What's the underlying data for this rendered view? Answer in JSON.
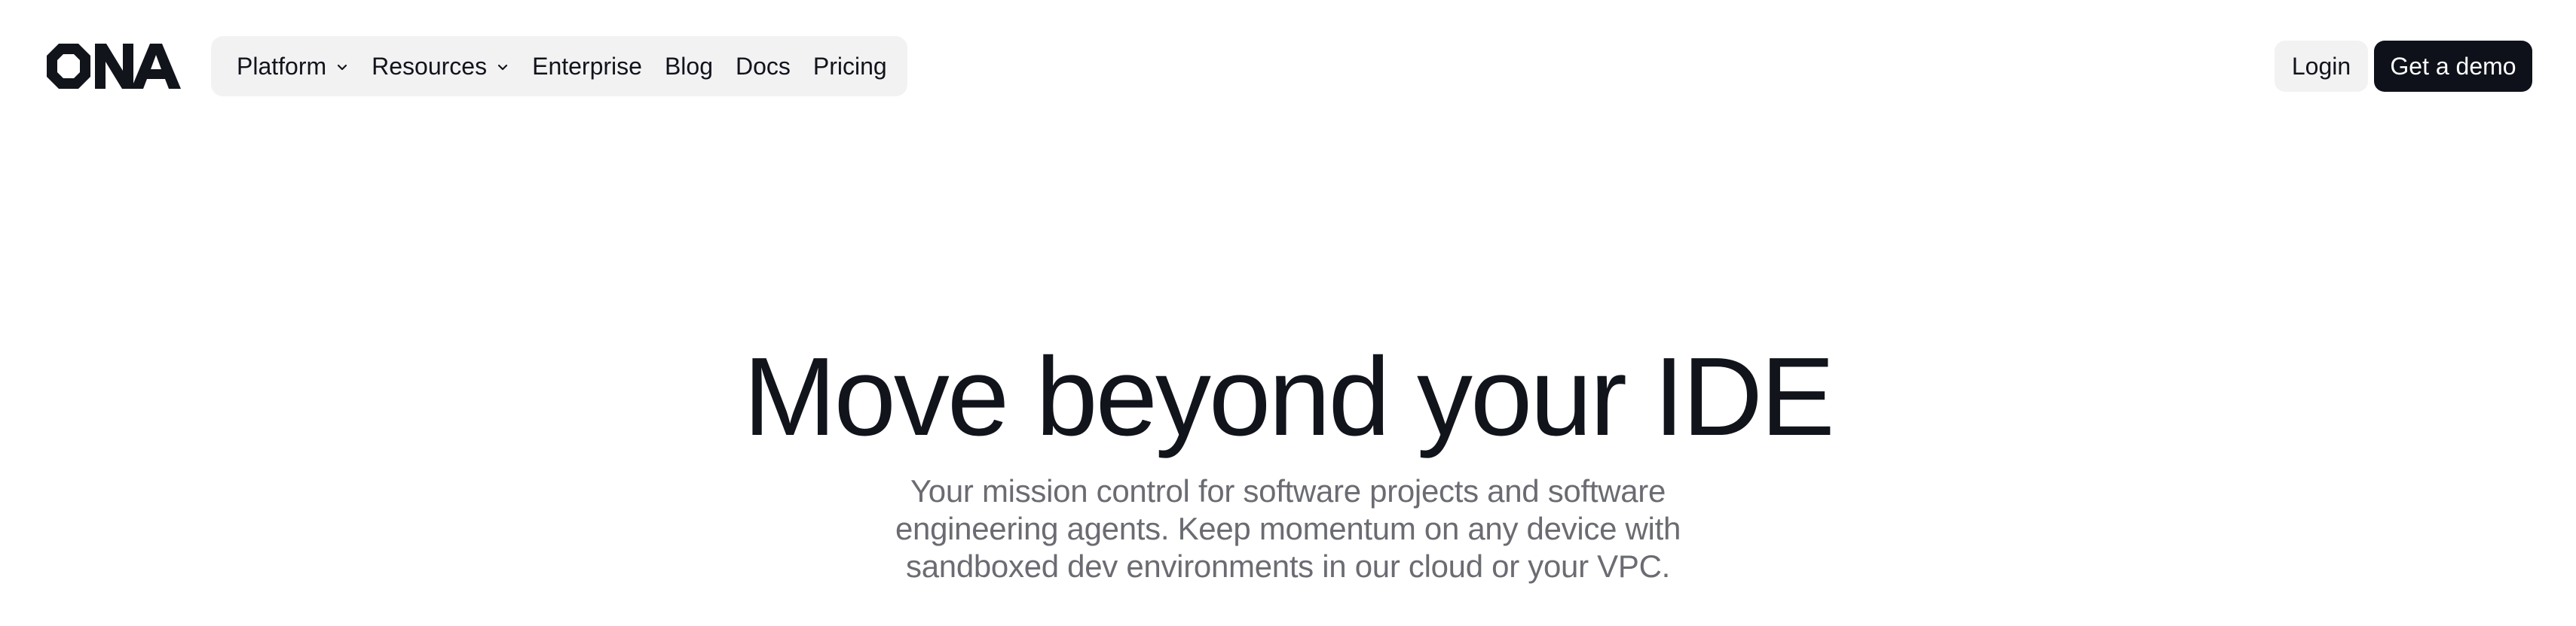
{
  "brand": {
    "logo_text": "ONA",
    "colors": {
      "text": "#12141c",
      "muted": "#6b6c72",
      "nav_bg": "#f2f2f3",
      "primary_button": "#0f111a"
    }
  },
  "nav": {
    "items": [
      {
        "label": "Platform",
        "icon": "chevron-down-icon"
      },
      {
        "label": "Resources",
        "icon": "chevron-down-icon"
      },
      {
        "label": "Enterprise"
      },
      {
        "label": "Blog"
      },
      {
        "label": "Docs"
      },
      {
        "label": "Pricing"
      }
    ]
  },
  "header_actions": {
    "login_label": "Login",
    "demo_label": "Get a demo"
  },
  "hero": {
    "title": "Move beyond your IDE",
    "subtitle": "Your mission control for software projects and software engineering agents. Keep momentum on any device with sandboxed dev environments in our cloud or your VPC."
  }
}
